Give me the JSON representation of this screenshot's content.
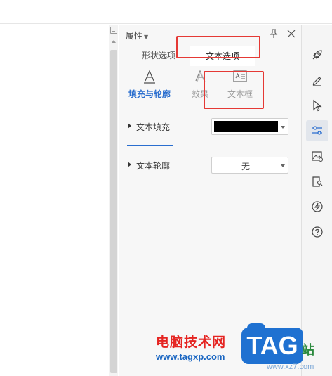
{
  "panel": {
    "title": "属性",
    "tabs": [
      {
        "label": "形状选项",
        "active": false
      },
      {
        "label": "文本选项",
        "active": true
      }
    ],
    "subtabs": [
      {
        "label": "填充与轮廓",
        "icon": "text-fill-icon",
        "active": true
      },
      {
        "label": "效果",
        "icon": "text-effect-icon",
        "active": false
      },
      {
        "label": "文本框",
        "icon": "text-box-icon",
        "active": false
      }
    ],
    "rows": [
      {
        "label": "文本填充",
        "control": "color-select",
        "value_color": "#000000"
      },
      {
        "label": "文本轮廓",
        "control": "select",
        "value": "无"
      }
    ]
  },
  "rightbar": {
    "icons": [
      "rocket-icon",
      "pen-icon",
      "cursor-icon",
      "sliders-icon",
      "image-edit-icon",
      "book-search-icon",
      "bolt-icon",
      "help-icon"
    ],
    "active_index": 3
  },
  "highlights": [
    "text-options-tab",
    "text-box-subtab"
  ],
  "watermark": {
    "site_name": "电脑技术网",
    "url": "www.tagxp.com",
    "badge": "TAG",
    "side_text": "极光下载站",
    "side_url": "www.xz7.com"
  },
  "colors": {
    "accent": "#2a6ecf",
    "highlight": "#e53935"
  }
}
